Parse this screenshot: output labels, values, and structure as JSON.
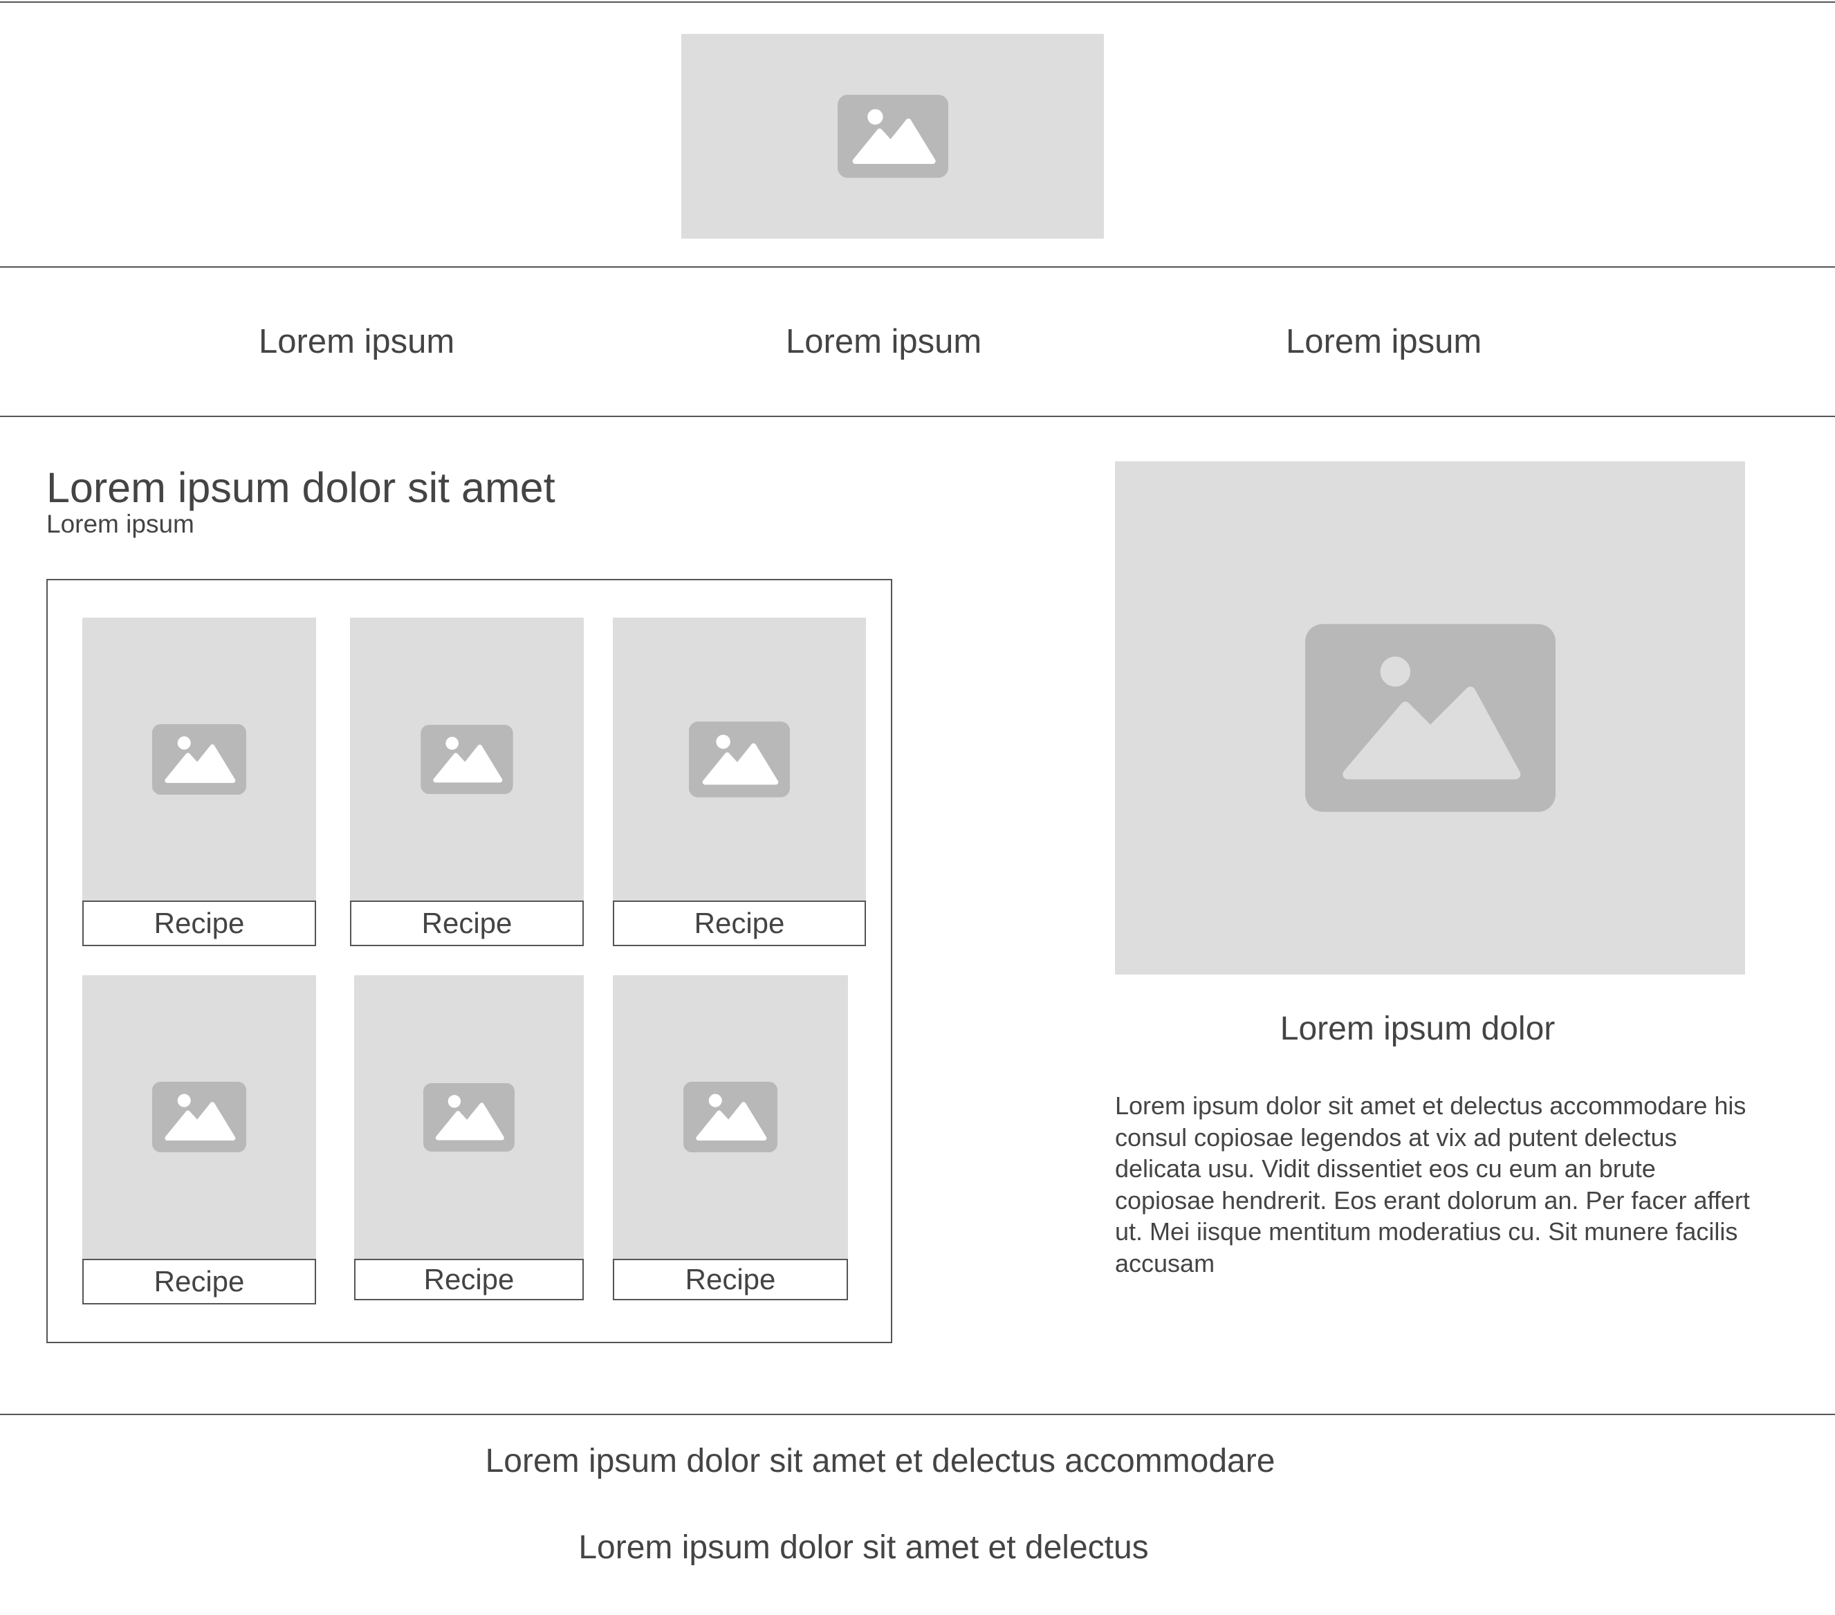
{
  "nav": {
    "items": [
      {
        "label": "Lorem ipsum"
      },
      {
        "label": "Lorem ipsum"
      },
      {
        "label": "Lorem ipsum"
      }
    ]
  },
  "main": {
    "title": "Lorem ipsum dolor sit amet",
    "subtitle": "Lorem ipsum",
    "cards": [
      {
        "label": "Recipe"
      },
      {
        "label": "Recipe"
      },
      {
        "label": "Recipe"
      },
      {
        "label": "Recipe"
      },
      {
        "label": "Recipe"
      },
      {
        "label": "Recipe"
      }
    ]
  },
  "feature": {
    "heading": "Lorem ipsum dolor",
    "body": "Lorem ipsum dolor sit amet et delectus accommodare his consul copiosae legendos at vix ad putent delectus delicata usu. Vidit dissentiet eos cu eum an brute copiosae hendrerit. Eos erant dolorum an. Per facer affert ut. Mei iisque mentitum moderatius cu. Sit munere facilis accusam"
  },
  "footer": {
    "line1": "Lorem ipsum dolor sit amet et delectus accommodare",
    "line2": "Lorem ipsum dolor sit amet et delectus"
  },
  "icons": {
    "image_placeholder": "image-placeholder-icon"
  },
  "colors": {
    "placeholder_bg": "#dddddd",
    "placeholder_icon": "#b8b8b8",
    "text": "#444444",
    "lines": "#555555"
  }
}
